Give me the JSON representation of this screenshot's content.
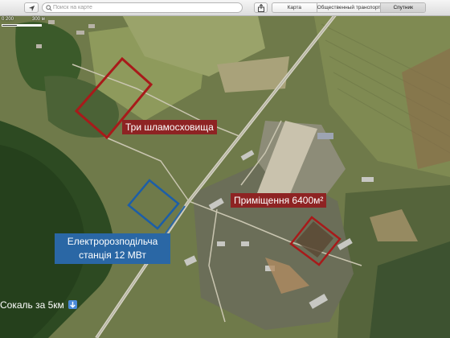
{
  "toolbar": {
    "locate_icon": "location-arrow-icon",
    "search_icon": "magnifier-icon",
    "search_placeholder": "Поиск на карте",
    "share_icon": "share-icon",
    "view_modes": [
      "Карта",
      "Общественный транспорт",
      "Спутник"
    ],
    "active_view": "Спутник"
  },
  "scale": {
    "labels": [
      "0",
      "200",
      "300 м"
    ]
  },
  "annotations": {
    "tailings": "Три шламосховища",
    "premises": "Приміщення 6400м²",
    "substation_line1": "Електророзподільча",
    "substation_line2": "станція 12 МВт",
    "sokal": "Сокаль за 5км",
    "down_arrow_icon": "down-arrow-icon"
  },
  "colors": {
    "red_label": "#8e2323",
    "blue_label": "#2a67a5",
    "red_outline": "#a81a1a",
    "blue_outline": "#1c5ea8"
  }
}
